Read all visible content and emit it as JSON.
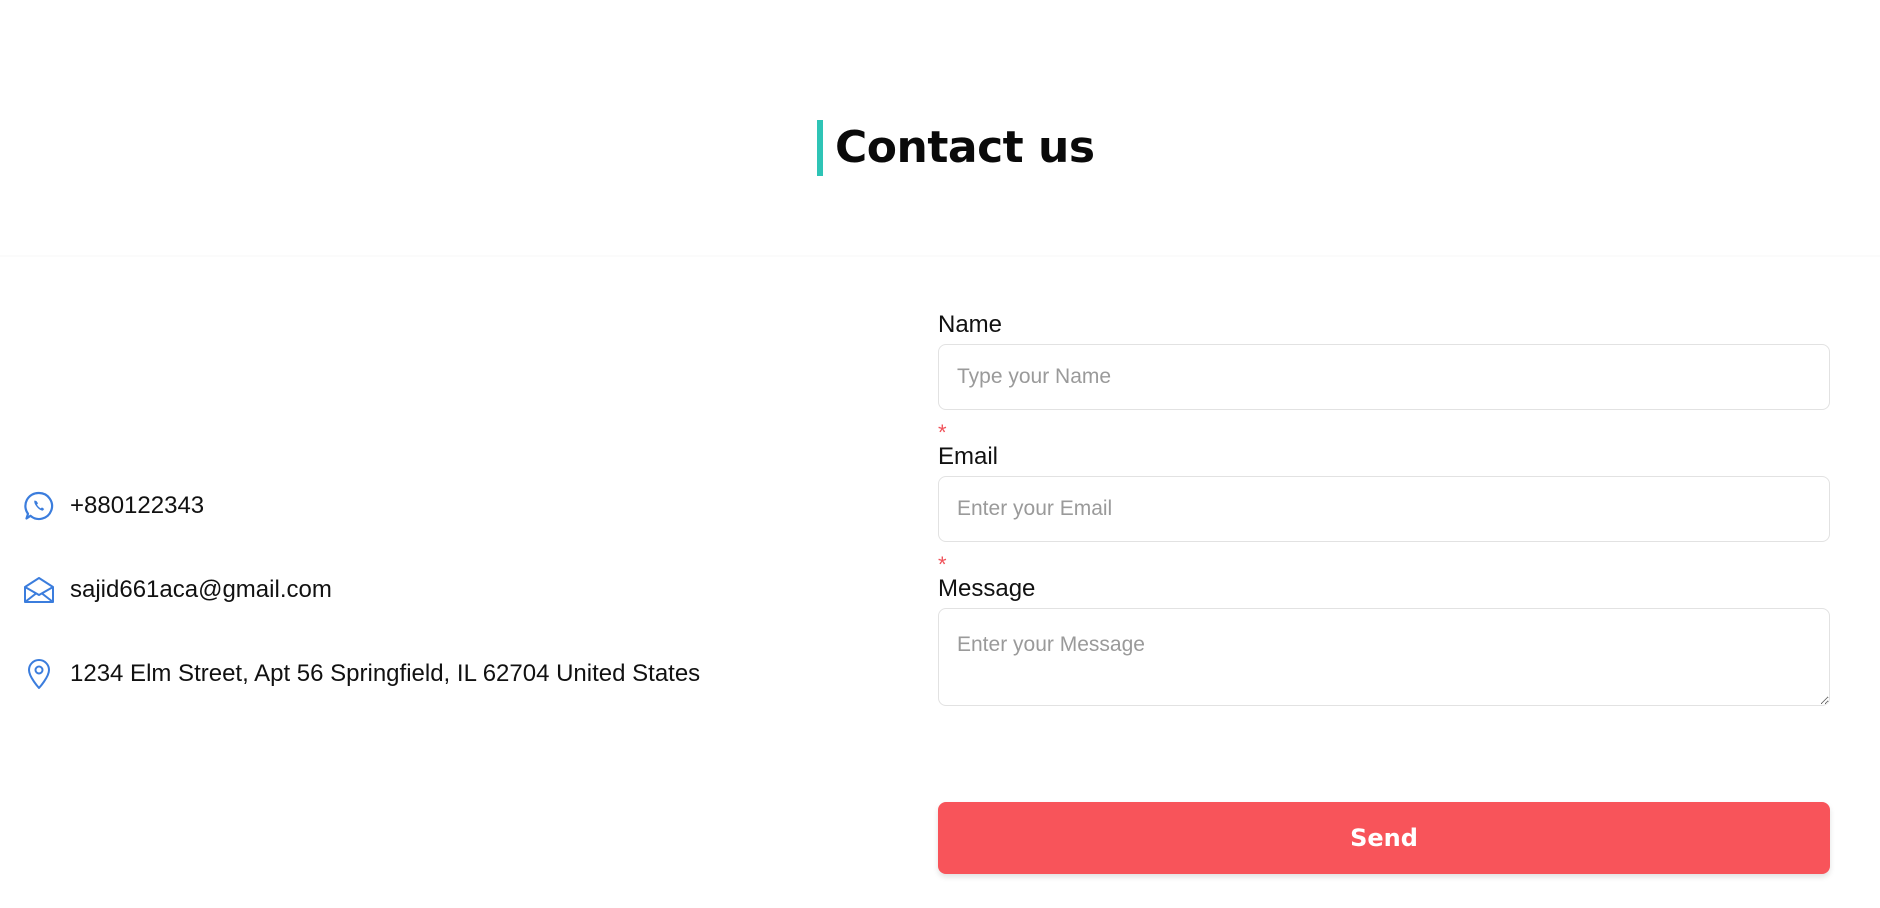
{
  "header": {
    "title": "Contact us",
    "accent_color": "#2ec4b6"
  },
  "contact_info": {
    "icon_color": "#3b7ddd",
    "items": [
      {
        "icon": "whatsapp-icon",
        "text": "+880122343"
      },
      {
        "icon": "envelope-icon",
        "text": "sajid661aca@gmail.com"
      },
      {
        "icon": "location-pin-icon",
        "text": "1234 Elm Street, Apt 56 Springfield, IL 62704 United States"
      }
    ]
  },
  "form": {
    "fields": [
      {
        "label": "Name",
        "placeholder": "Type your Name",
        "value": ""
      },
      {
        "label": "Email",
        "placeholder": "Enter your Email",
        "value": "",
        "required_mark": "*"
      },
      {
        "label": "Message",
        "placeholder": "Enter your Message",
        "value": "",
        "required_mark": "*"
      }
    ],
    "submit_label": "Send",
    "submit_color": "#f8545a"
  }
}
